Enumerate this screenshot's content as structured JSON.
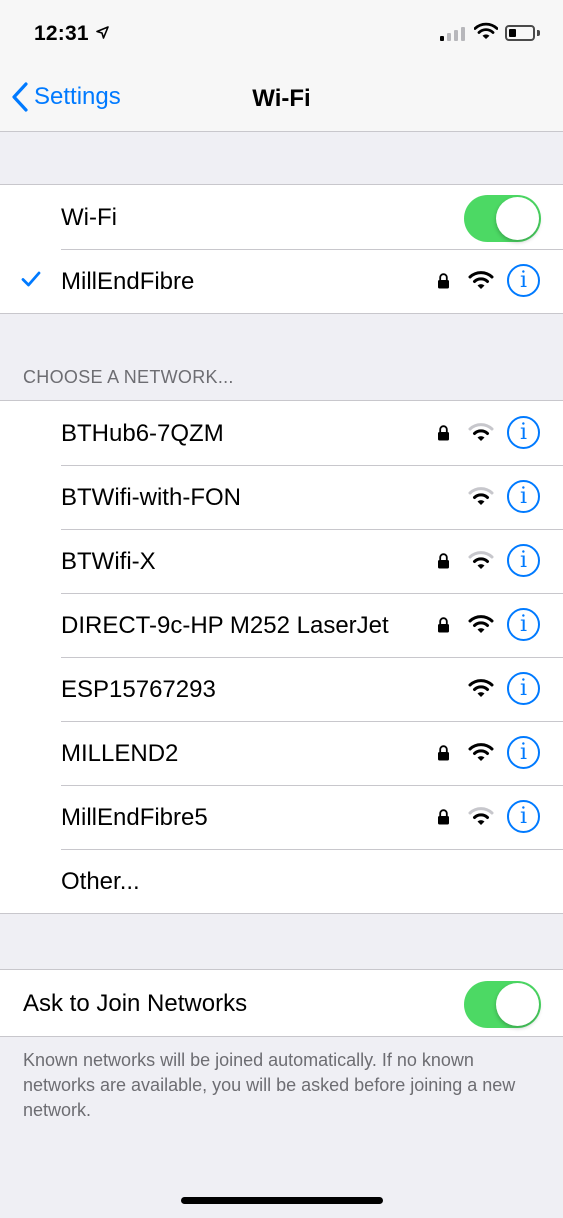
{
  "status_bar": {
    "time": "12:31",
    "icons": [
      "location-arrow-icon",
      "cellular-signal-icon",
      "wifi-icon",
      "battery-icon"
    ]
  },
  "nav": {
    "back_label": "Settings",
    "title": "Wi-Fi"
  },
  "wifi_toggle": {
    "label": "Wi-Fi",
    "on": true
  },
  "connected": {
    "name": "MillEndFibre",
    "secured": true,
    "signal": "strong"
  },
  "choose_header": "CHOOSE A NETWORK...",
  "networks": [
    {
      "name": "BTHub6-7QZM",
      "secured": true,
      "signal": "weak"
    },
    {
      "name": "BTWifi-with-FON",
      "secured": false,
      "signal": "weak"
    },
    {
      "name": "BTWifi-X",
      "secured": true,
      "signal": "weak"
    },
    {
      "name": "DIRECT-9c-HP M252 LaserJet",
      "secured": true,
      "signal": "strong"
    },
    {
      "name": "ESP15767293",
      "secured": false,
      "signal": "strong"
    },
    {
      "name": "MILLEND2",
      "secured": true,
      "signal": "strong"
    },
    {
      "name": "MillEndFibre5",
      "secured": true,
      "signal": "weak"
    }
  ],
  "other_label": "Other...",
  "ask_to_join": {
    "label": "Ask to Join Networks",
    "on": true
  },
  "footer_note": "Known networks will be joined automatically. If no known networks are available, you will be asked before joining a new network.",
  "colors": {
    "accent": "#007aff",
    "toggle_on": "#4cd964",
    "background": "#efeff4"
  }
}
